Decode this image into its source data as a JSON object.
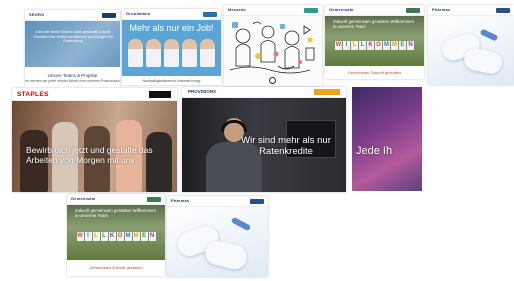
{
  "colors": {
    "navy_logo": "#1a3b6b",
    "staples_red": "#cc0000",
    "cta_orange": "#f0a11e",
    "footer_red": "#c04a3a",
    "hero_blue": "#5aa5d6",
    "purple": "#7a3c8a"
  },
  "tiles": {
    "t1": {
      "logo": "SEGRO",
      "hero_text": "Lohn der Beste Team in Alles geschafft Zukunft Gestalten hier Hoffen wir Arbeiten von Morgen mit Entwicklung",
      "subtitle": "Unsere Teams & Projekte",
      "subline": "es werden wir jeder wieder Arbeit vom unseren Potenzialen"
    },
    "t2": {
      "logo": "Grundmann",
      "headline": "Mehr als nur ein Job!",
      "footer": "Nachhaltigkeitsbericht Unterzeichnung"
    },
    "t3": {
      "logo": "Mecardo"
    },
    "t4": {
      "logo": "Gemeinsam",
      "welcome_text": "Zukunft gemeinsam gestalten Willkommen in unserem Team",
      "letters": [
        "W",
        "I",
        "L",
        "L",
        "K",
        "O",
        "M",
        "M",
        "E",
        "N"
      ],
      "footer": "Gemeinsam Zukunft gestalten"
    },
    "t5": {
      "logo": "Pharmas"
    },
    "t6": {
      "brand": "STAPLES",
      "claim": "Bewirb dich jetzt und gestalte das Arbeiten von Morgen mit uns"
    },
    "t7": {
      "brand": "PROVISIONS",
      "claim": "Wir sind mehr als nur Ratenkredite"
    },
    "t8": {
      "claim": "Jede Ih"
    },
    "t9": {
      "logo": "Gemeinsam",
      "welcome_text": "Zukunft gemeinsam gestalten Willkommen in unserem Team",
      "letters": [
        "W",
        "I",
        "L",
        "L",
        "K",
        "O",
        "M",
        "M",
        "E",
        "N"
      ],
      "footer": "Gemeinsam Zukunft gestalten"
    },
    "t10": {
      "logo": "Pharmas"
    }
  }
}
